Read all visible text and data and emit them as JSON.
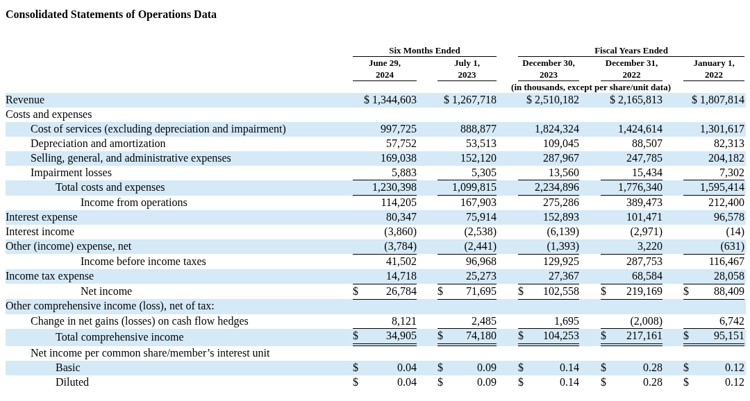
{
  "title": "Consolidated Statements of Operations Data",
  "column_groups": [
    {
      "label": "Six Months Ended",
      "columns": [
        {
          "lines": [
            "June 29,",
            "2024"
          ]
        },
        {
          "lines": [
            "July 1,",
            "2023"
          ]
        }
      ]
    },
    {
      "label": "Fiscal Years Ended",
      "columns": [
        {
          "lines": [
            "December 30,",
            "2023"
          ]
        },
        {
          "lines": [
            "December 31,",
            "2022"
          ]
        },
        {
          "lines": [
            "January 1,",
            "2022"
          ]
        }
      ]
    }
  ],
  "units_note": "(in thousands, except per share/unit data)",
  "rows": [
    {
      "label": "Revenue",
      "kind": "plain",
      "shaded": true,
      "underlined": false,
      "double_underlined": false,
      "cells": [
        "$ 1,344,603",
        "$ 1,267,718",
        "$ 2,510,182",
        "$ 2,165,813",
        "$ 1,807,814"
      ]
    },
    {
      "label": "Costs and expenses",
      "kind": "plain",
      "shaded": false,
      "underlined": false,
      "double_underlined": false
    },
    {
      "label": "Cost of services (excluding depreciation and impairment)",
      "kind": "item",
      "shaded": true,
      "underlined": false,
      "double_underlined": false,
      "cells": [
        "997,725",
        "888,877",
        "1,824,324",
        "1,424,614",
        "1,301,617"
      ]
    },
    {
      "label": "Depreciation and amortization",
      "kind": "item",
      "shaded": false,
      "underlined": false,
      "double_underlined": false,
      "cells": [
        "57,752",
        "53,513",
        "109,045",
        "88,507",
        "82,313"
      ]
    },
    {
      "label": "Selling, general, and administrative expenses",
      "kind": "item",
      "shaded": true,
      "underlined": false,
      "double_underlined": false,
      "cells": [
        "169,038",
        "152,120",
        "287,967",
        "247,785",
        "204,182"
      ]
    },
    {
      "label": "Impairment losses",
      "kind": "item",
      "shaded": false,
      "underlined": true,
      "double_underlined": false,
      "cells": [
        "5,883",
        "5,305",
        "13,560",
        "15,434",
        "7,302"
      ]
    },
    {
      "label": "Total costs and expenses",
      "kind": "subitem",
      "shaded": true,
      "underlined": true,
      "double_underlined": false,
      "cells": [
        "1,230,398",
        "1,099,815",
        "2,234,896",
        "1,776,340",
        "1,595,414"
      ]
    },
    {
      "label": "Income from operations",
      "kind": "summary",
      "shaded": false,
      "underlined": false,
      "double_underlined": false,
      "cells": [
        "114,205",
        "167,903",
        "275,286",
        "389,473",
        "212,400"
      ]
    },
    {
      "label": "Interest expense",
      "kind": "plain",
      "shaded": true,
      "underlined": false,
      "double_underlined": false,
      "cells": [
        "80,347",
        "75,914",
        "152,893",
        "101,471",
        "96,578"
      ]
    },
    {
      "label": "Interest income",
      "kind": "plain",
      "shaded": false,
      "underlined": false,
      "double_underlined": false,
      "cells": [
        "(3,860)",
        "(2,538)",
        "(6,139)",
        "(2,971)",
        "(14)"
      ]
    },
    {
      "label": "Other (income) expense, net",
      "kind": "plain",
      "shaded": true,
      "underlined": true,
      "double_underlined": false,
      "cells": [
        "(3,784)",
        "(2,441)",
        "(1,393)",
        "3,220",
        "(631)"
      ]
    },
    {
      "label": "Income before income taxes",
      "kind": "summary",
      "shaded": false,
      "underlined": false,
      "double_underlined": false,
      "cells": [
        "41,502",
        "96,968",
        "129,925",
        "287,753",
        "116,467"
      ]
    },
    {
      "label": "Income tax expense",
      "kind": "plain",
      "shaded": true,
      "underlined": true,
      "double_underlined": false,
      "cells": [
        "14,718",
        "25,273",
        "27,367",
        "68,584",
        "28,058"
      ]
    },
    {
      "label": "Net income",
      "kind": "summary",
      "shaded": false,
      "underlined": true,
      "double_underlined": false,
      "cells": [
        {
          "currency": "$",
          "amount": "26,784"
        },
        {
          "currency": "$",
          "amount": "71,695"
        },
        {
          "currency": "$",
          "amount": "102,558"
        },
        {
          "currency": "$",
          "amount": "219,169"
        },
        {
          "currency": "$",
          "amount": "88,409"
        }
      ]
    },
    {
      "label": "Other comprehensive income (loss), net of tax:",
      "kind": "plain",
      "shaded": true,
      "underlined": false,
      "double_underlined": false
    },
    {
      "label": "Change in net gains (losses) on cash flow hedges",
      "kind": "item",
      "shaded": false,
      "underlined": true,
      "double_underlined": false,
      "cells": [
        "8,121",
        "2,485",
        "1,695",
        "(2,008)",
        "6,742"
      ]
    },
    {
      "label": "Total comprehensive income",
      "kind": "subitem",
      "shaded": true,
      "underlined": true,
      "double_underlined": true,
      "cells": [
        {
          "currency": "$",
          "amount": "34,905"
        },
        {
          "currency": "$",
          "amount": "74,180"
        },
        {
          "currency": "$",
          "amount": "104,253"
        },
        {
          "currency": "$",
          "amount": "217,161"
        },
        {
          "currency": "$",
          "amount": "95,151"
        }
      ]
    },
    {
      "label": "Net income per common share/member’s interest unit",
      "kind": "item",
      "shaded": false,
      "underlined": false,
      "double_underlined": false
    },
    {
      "label": "Basic",
      "kind": "subitem",
      "shaded": true,
      "underlined": false,
      "double_underlined": false,
      "cells": [
        {
          "currency": "$",
          "amount": "0.04"
        },
        {
          "currency": "$",
          "amount": "0.09"
        },
        {
          "currency": "$",
          "amount": "0.14"
        },
        {
          "currency": "$",
          "amount": "0.28"
        },
        {
          "currency": "$",
          "amount": "0.12"
        }
      ]
    },
    {
      "label": "Diluted",
      "kind": "subitem",
      "shaded": false,
      "underlined": false,
      "double_underlined": false,
      "cells": [
        {
          "currency": "$",
          "amount": "0.04"
        },
        {
          "currency": "$",
          "amount": "0.09"
        },
        {
          "currency": "$",
          "amount": "0.14"
        },
        {
          "currency": "$",
          "amount": "0.28"
        },
        {
          "currency": "$",
          "amount": "0.12"
        }
      ]
    }
  ]
}
